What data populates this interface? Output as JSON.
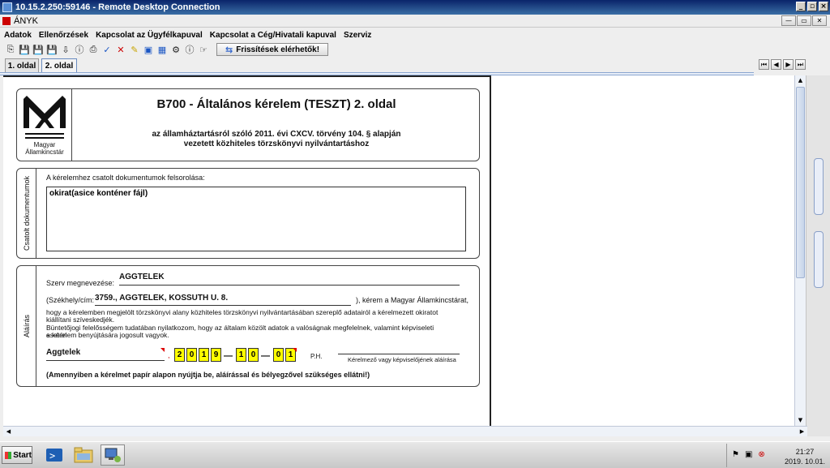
{
  "rdp_window": {
    "title": "10.15.2.250:59146 - Remote Desktop Connection"
  },
  "app": {
    "title": "ÁNYK",
    "menu": [
      "Adatok",
      "Ellenőrzések",
      "Kapcsolat az Ügyfélkapuval",
      "Kapcsolat a Cég/Hivatali kapuval",
      "Szerviz"
    ],
    "toolbar_icons": [
      "new-doc-icon",
      "save-icon",
      "save-as-icon",
      "save-all-icon",
      "import-icon",
      "info-book-icon",
      "print-icon",
      "check-icon",
      "delete-icon",
      "highlight-icon",
      "send-icon",
      "calculator-icon",
      "attach-icon",
      "info-icon",
      "hand-icon"
    ],
    "update_button": "Frissítések elérhetők!",
    "tabs": [
      "1. oldal",
      "2. oldal"
    ],
    "active_tab": 1
  },
  "form": {
    "logo_text_1": "Magyar",
    "logo_text_2": "Államkincstár",
    "title": "B700 - Általános kérelem (TESZT) 2. oldal",
    "subtitle_1": "az államháztartásról szóló 2011. évi CXCV. törvény 104. § alapján",
    "subtitle_2": "vezetett közhiteles törzskönyvi nyilvántartáshoz",
    "attachments": {
      "side_label": "Csatolt dokumentumok",
      "caption": "A kérelemhez csatolt dokumentumok felsorolása:",
      "value": "okirat(asice konténer fájl)"
    },
    "signature": {
      "side_label": "Aláírás",
      "org_label": "Szerv megnevezése:",
      "org_value": "AGGTELEK",
      "address_label": "(Székhely/cím:",
      "address_value": "3759., AGGTELEK, KOSSUTH U. 8.",
      "address_suffix": "), kérem a Magyar Államkincstárat,",
      "para_1": "hogy a kérelemben megjelölt törzskönyvi alany közhiteles törzskönyvi nyilvántartásában szereplő adatairól a kérelmezett okiratot",
      "para_2": "kiállítani szíveskedjék.",
      "para_3": "Büntetőjogi felelősségem tudatában nyilatkozom, hogy az általam közölt adatok a valóságnak megfelelnek, valamint képviseleti esetén",
      "para_4": "a kérelem benyújtására jogosult vagyok.",
      "place_value": "Aggtelek",
      "comma": ",",
      "date_digits": [
        "2",
        "0",
        "1",
        "9",
        "1",
        "0",
        "0",
        "1"
      ],
      "ph_label": "P.H.",
      "signer_label": "Kérelmező vagy képviselőjének aláírása",
      "notice": "(Amennyiben a kérelmet papír alapon nyújtja be, aláírással és bélyegzővel szükséges ellátni!)"
    }
  },
  "taskbar": {
    "start_label": "Start",
    "time": "21:27",
    "date": "2019. 10.01."
  }
}
